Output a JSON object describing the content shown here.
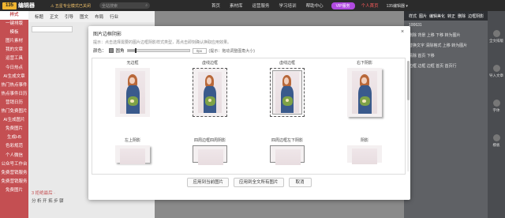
{
  "topbar": {
    "logo_badge": "135",
    "logo_text": "编辑器",
    "notice": "⚠ 五星专业模式已关闭",
    "search_placeholder": "全站搜索",
    "nav": [
      "首页",
      "素材库",
      "运营服务",
      "学习培训",
      "帮助中心"
    ],
    "vip": "VIP服务",
    "user": "个人首页",
    "account": "135编辑器 ▾"
  },
  "sidebar": {
    "items": [
      "样式",
      "一键排版",
      "模板",
      "图片素材",
      "我的文章",
      "运营工具",
      "今日热点",
      "AI生成文章",
      "热门热点事件",
      "热点事件日历",
      "营销日历",
      "热门免费图片",
      "AI生成图片",
      "免费图片",
      "生成H5",
      "色彩规范",
      "个人微信",
      "公众号工作台",
      "免费营销服务",
      "免费营销服务",
      "免费图片"
    ],
    "active_index": 0
  },
  "editor": {
    "tabs": [
      "标题",
      "正文",
      "引导",
      "图文",
      "布局",
      "行业"
    ],
    "article_title": "3 拒绝最后 ·",
    "article_line": "分 析 开 拓 步 骤"
  },
  "rpanel": {
    "header": [
      "样式",
      "图片",
      "编辑美化",
      "转正",
      "删除",
      "边框阴影"
    ],
    "lines": [
      "100631",
      "删除  背景  上移  下移  转为图片",
      "替换文字  清除格式  上移  转为图片",
      "清除  首页  下移",
      "边框  边框  边框  首页  首页行"
    ]
  },
  "rstrip": {
    "items": [
      "全文排版",
      "导入文章",
      "字体",
      "模板"
    ]
  },
  "modal": {
    "title": "图片边框阴影",
    "close": "×",
    "tip": "提示：点击选择需要的图片边框阴影样式类型，再点击即刻确认换取应用效果。",
    "color_label": "颜色：",
    "radius_label": "圆角",
    "px_value": "0px",
    "hint": "(提示：拖动调整图角大小)",
    "slider_fraction": 0.12,
    "row1": [
      "无边框",
      "虚线边框",
      "虚线边框",
      "右下阴影"
    ],
    "row2": [
      "左上阴影",
      "四周边框四周阴影",
      "四周边框左下阴影",
      "阴影"
    ],
    "buttons": {
      "apply": "应用到当前图片",
      "apply_all": "应用到全文所有图片",
      "cancel": "取消"
    }
  }
}
